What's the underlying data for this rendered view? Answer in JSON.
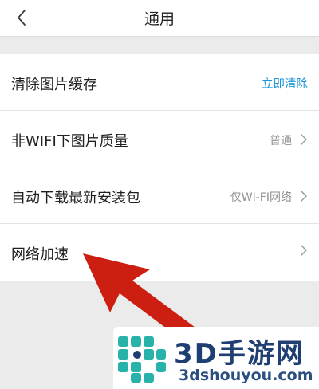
{
  "header": {
    "title": "通用",
    "back_icon": "chevron-left-icon"
  },
  "settings": {
    "items": [
      {
        "label": "清除图片缓存",
        "action": "立即清除"
      },
      {
        "label": "非WIFI下图片质量",
        "value": "普通"
      },
      {
        "label": "自动下载最新安装包",
        "value": "仅WI-FI网络"
      },
      {
        "label": "网络加速"
      }
    ]
  },
  "watermark": {
    "name": "3D手游网",
    "domain": "3dshouyou.com"
  },
  "colors": {
    "accent": "#1e96d7",
    "arrow": "#cc1f12",
    "watermark_teal": "#27b3a9",
    "watermark_navy": "#1f3f73"
  }
}
